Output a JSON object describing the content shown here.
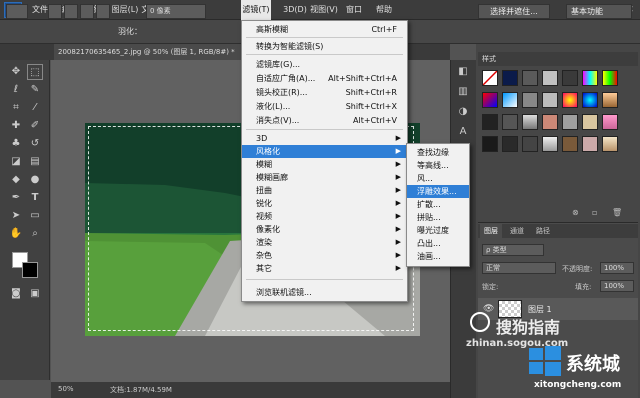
{
  "app": {
    "logo": "Ps"
  },
  "menubar": [
    "文件(F)",
    "编辑(E)",
    "图像(I)",
    "图层(L)",
    "文字(Y)",
    "选择(S)",
    "滤镜(T)",
    "3D(D)",
    "视图(V)",
    "窗口(W)",
    "帮助(H)"
  ],
  "active_menu": "滤镜(T)",
  "options": {
    "feather_label": "羽化：",
    "feather_value": "0 像素",
    "select_btn": "选择并遮住...",
    "workspace": "基本功能"
  },
  "document": {
    "tab": "20082170635465_2.jpg @ 50% (图层 1, RGB/8#) *",
    "zoom": "50%",
    "doc_info": "文档:1.87M/4.59M"
  },
  "filter_menu": {
    "items": [
      {
        "label": "高斯模糊",
        "shortcut": "Ctrl+F"
      },
      {
        "label": "转换为智能滤镜(S)",
        "shortcut": ""
      },
      {
        "label": "滤镜库(G)...",
        "shortcut": ""
      },
      {
        "label": "自适应广角(A)...",
        "shortcut": "Alt+Shift+Ctrl+A"
      },
      {
        "label": "镜头校正(R)...",
        "shortcut": "Shift+Ctrl+R"
      },
      {
        "label": "液化(L)...",
        "shortcut": "Shift+Ctrl+X"
      },
      {
        "label": "消失点(V)...",
        "shortcut": "Alt+Ctrl+V"
      },
      {
        "label": "3D",
        "shortcut": ""
      },
      {
        "label": "风格化",
        "shortcut": ""
      },
      {
        "label": "模糊",
        "shortcut": ""
      },
      {
        "label": "模糊画廊",
        "shortcut": ""
      },
      {
        "label": "扭曲",
        "shortcut": ""
      },
      {
        "label": "锐化",
        "shortcut": ""
      },
      {
        "label": "视频",
        "shortcut": ""
      },
      {
        "label": "像素化",
        "shortcut": ""
      },
      {
        "label": "渲染",
        "shortcut": ""
      },
      {
        "label": "杂色",
        "shortcut": ""
      },
      {
        "label": "其它",
        "shortcut": ""
      },
      {
        "label": "浏览联机滤镜...",
        "shortcut": ""
      }
    ]
  },
  "stylize_submenu": [
    "查找边缘",
    "等高线...",
    "风...",
    "浮雕效果...",
    "扩散...",
    "拼贴...",
    "曝光过度",
    "凸出...",
    "油画..."
  ],
  "highlighted_sub": "浮雕效果...",
  "styles_panel": {
    "tab": "样式"
  },
  "layers_panel": {
    "tabs": [
      "图层",
      "通道",
      "路径"
    ],
    "kind": "ρ 类型",
    "blend": "正常",
    "opacity_label": "不透明度:",
    "opacity": "100%",
    "lock_label": "锁定:",
    "fill_label": "填充:",
    "fill": "100%",
    "layer_name": "图层 1"
  },
  "watermarks": {
    "sogou": "搜狗指南",
    "sogou_url": "zhinan.sogou.com",
    "xtc": "系统城",
    "xtc_url": "xitongcheng.com"
  },
  "colors": {
    "accent": "#2f7fd6",
    "menu_bg": "#f1f1f1",
    "ui_dark": "#3c3c3c",
    "canvas_bg": "#616161"
  }
}
